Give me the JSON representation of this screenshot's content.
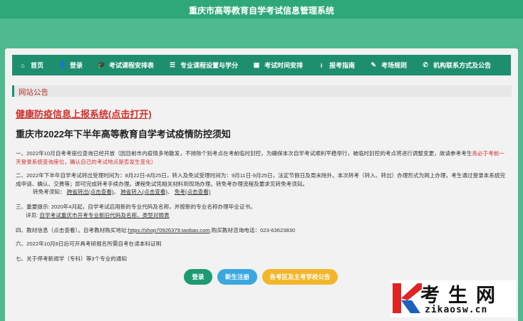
{
  "header": {
    "title": "重庆市高等教育自学考试信息管理系统"
  },
  "nav": [
    {
      "icon": "home-icon",
      "glyph": "⌂",
      "label": "首页"
    },
    {
      "icon": "user-icon",
      "glyph": "👤",
      "label": "登录"
    },
    {
      "icon": "graduation-cap-icon",
      "glyph": "🎓",
      "label": "考试课程安排表"
    },
    {
      "icon": "list-icon",
      "glyph": "☰",
      "label": "专业课程设置与学分"
    },
    {
      "icon": "calendar-icon",
      "glyph": "▦",
      "label": "考试时间安排"
    },
    {
      "icon": "info-icon",
      "glyph": "i",
      "label": "报考指南"
    },
    {
      "icon": "pencil-icon",
      "glyph": "✎",
      "label": "考场规则"
    },
    {
      "icon": "phone-icon",
      "glyph": "✆",
      "label": "机构联系方式及公告"
    }
  ],
  "notice": {
    "label": "网站公告"
  },
  "epidemic_link": "健康防疫信息上报系统(点击打开)",
  "headline": "重庆市2022年下半年高等教育自学考试疫情防控须知",
  "items": {
    "p1a": "一、2022年10月自考考座位查询已经开放（因目前市内疫情多地散发，不排除个别考点在考前临时封控，为确保本次自学考试顺利平稳举行，被临时封控的考点将进行调整变更，故请参考考生",
    "p1b": "务必于考前一天登录系统查询座位，确认自己的考试地点是否发生变化）",
    "p2": "二、2022年下半年自学考试转出受理时间为：8月22日-8月25日，转入及免试受理时间为：9月11日-9月25日，法定节假日及周末除外。本次转考（转入、转出）办理形式为网上办理，考生通过登录本系统完成申请、确认、交费等；即可完成转考手续办理。课程免试凭相关材料到现场办理。转免考办理流程及要求见转免考须知。",
    "p2b_lead": "转免考须知：",
    "p2b_l1": "跨省转出(点击查看)",
    "p2b_l2": "跨省转入(点击查看)",
    "p2b_l3": "免考(点击查看)",
    "p3a": "三、重要提示: 2020年4月起，自学考试启用新的专业代码及名称，并按新的专业名称办理毕业证书。",
    "p3b_lead": "详见: ",
    "p3b_link": "自学考试重庆市开考专业新旧代码及名称、类型对照表",
    "p4_lead": "四、教材信息（点击查看）。自考教材购买地址:",
    "p4_link": "https://shop70926379.taobao.com",
    "p4_tail": ",购买教材咨询电话：023-63623830",
    "p5": "六、2022年10月8日后可开具考研报名所需自考在读本科证明",
    "p6": "七、关于停考新闻学（专科）等3个专业的通知"
  },
  "buttons": [
    {
      "label": "登录",
      "color": "#1d9a72"
    },
    {
      "label": "新生注册",
      "color": "#3aa7e0"
    },
    {
      "label": "各考区及主考学校公告",
      "color": "#f3b62a"
    }
  ],
  "watermark": {
    "cn": "考生网",
    "en": "zikaosw.cn"
  },
  "colors": {
    "brand": "#2fa879",
    "nav": "#1d8f6e",
    "accent_red": "#d0312d"
  }
}
